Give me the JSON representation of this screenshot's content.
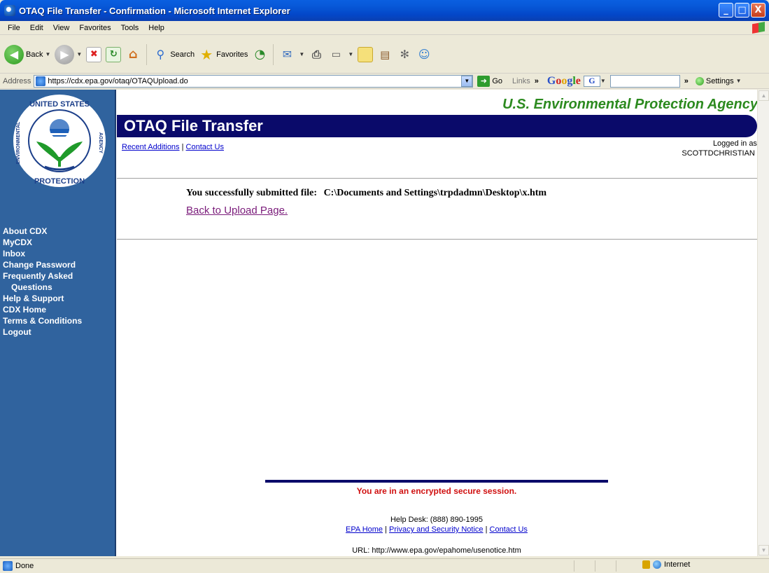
{
  "window": {
    "title": "OTAQ File Transfer - Confirmation - Microsoft Internet Explorer",
    "minimize": "_",
    "maximize": "□",
    "close": "X"
  },
  "menu": [
    "File",
    "Edit",
    "View",
    "Favorites",
    "Tools",
    "Help"
  ],
  "toolbar": {
    "back_label": "Back",
    "search_label": "Search",
    "favorites_label": "Favorites"
  },
  "addressbar": {
    "label": "Address",
    "url": "https://cdx.epa.gov/otaq/OTAQUpload.do",
    "go_label": "Go",
    "links_label": "Links",
    "google_g": "G",
    "settings_label": "Settings"
  },
  "sidebar": {
    "nav": [
      {
        "label": "About CDX",
        "indent": false
      },
      {
        "label": "MyCDX",
        "indent": false
      },
      {
        "label": "Inbox",
        "indent": false
      },
      {
        "label": "Change Password",
        "indent": false
      },
      {
        "label": "Frequently Asked",
        "indent": false
      },
      {
        "label": "Questions",
        "indent": true
      },
      {
        "label": "Help & Support",
        "indent": false
      },
      {
        "label": "CDX Home",
        "indent": false
      },
      {
        "label": "Terms & Conditions",
        "indent": false
      },
      {
        "label": "Logout",
        "indent": false
      }
    ]
  },
  "logo": {
    "top_text": "UNITED STATES",
    "left_text": "ENVIRONMENTAL",
    "right_text": "AGENCY",
    "bottom_text": "PROTECTION"
  },
  "header": {
    "agency": "U.S. Environmental Protection Agency",
    "banner_title": "OTAQ File Transfer",
    "recent_additions": "Recent Additions",
    "link_sep": "|",
    "contact_us": "Contact Us",
    "logged_in_label": "Logged in as,",
    "username": "SCOTTDCHRISTIAN ."
  },
  "main": {
    "success_prefix": "You successfully submitted file:",
    "file_path": "C:\\Documents and Settings\\trpdadmn\\Desktop\\x.htm",
    "back_link": "Back to Upload Page."
  },
  "footer": {
    "secure_message": "You are in an encrypted secure session.",
    "helpdesk": "Help Desk: (888) 890-1995",
    "epa_home": "EPA Home",
    "sep": "|",
    "privacy": "Privacy and Security Notice",
    "contact": "Contact Us",
    "url_text": "URL: http://www.epa.gov/epahome/usenotice.htm"
  },
  "status": {
    "text": "Done",
    "zone": "Internet"
  },
  "colors": {
    "sidebar": "#30639e",
    "banner": "#0a0a6a",
    "agency_green": "#2c8a1f",
    "secure_red": "#d01010"
  }
}
